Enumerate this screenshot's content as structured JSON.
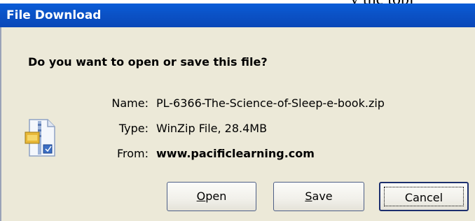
{
  "background": {
    "text": "y the topi"
  },
  "window": {
    "title": "File Download"
  },
  "dialog": {
    "question": "Do you want to open or save this file?",
    "file_icon": "winzip-file-icon",
    "fields": {
      "name_label": "Name:",
      "name_value": "PL-6366-The-Science-of-Sleep-e-book.zip",
      "type_label": "Type:",
      "type_value": "WinZip File, 28.4MB",
      "from_label": "From:",
      "from_value": "www.pacificlearning.com"
    }
  },
  "buttons": {
    "open_mnemonic": "O",
    "open_rest": "pen",
    "save_mnemonic": "S",
    "save_rest": "ave",
    "cancel_label": "Cancel"
  },
  "colors": {
    "titlebar": "#0a52c7",
    "dialog_bg": "#ece9d8"
  }
}
